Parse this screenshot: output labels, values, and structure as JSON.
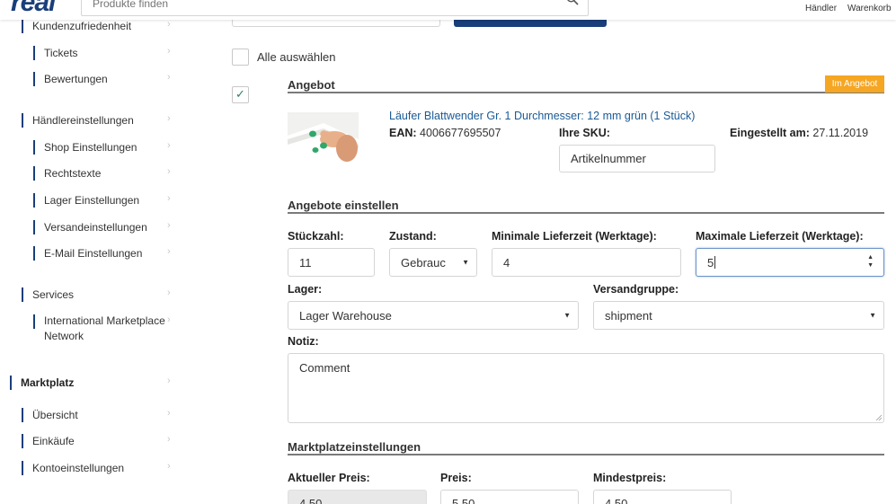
{
  "header": {
    "logo": "real",
    "search_placeholder": "Produkte finden",
    "haendler": "Händler",
    "warenkorb": "Warenkorb"
  },
  "sidebar": {
    "items": [
      {
        "label": "Kundenzufriedenheit"
      },
      {
        "label": "Tickets"
      },
      {
        "label": "Bewertungen"
      },
      {
        "label": "Händlereinstellungen"
      },
      {
        "label": "Shop Einstellungen"
      },
      {
        "label": "Rechtstexte"
      },
      {
        "label": "Lager Einstellungen"
      },
      {
        "label": "Versandeinstellungen"
      },
      {
        "label": "E-Mail Einstellungen"
      },
      {
        "label": "Services"
      },
      {
        "label": "International Marketplace Network"
      },
      {
        "label": "Marktplatz"
      },
      {
        "label": "Übersicht"
      },
      {
        "label": "Einkäufe"
      },
      {
        "label": "Kontoeinstellungen"
      }
    ]
  },
  "select_all": {
    "label": "Alle auswählen",
    "checked": false
  },
  "offer": {
    "checked": true,
    "title": "Angebot",
    "badge": "Im Angebot",
    "product_title": "Läufer Blattwender Gr. 1 Durchmesser: 12 mm grün (1 Stück)",
    "ean_label": "EAN:",
    "ean_value": "4006677695507",
    "sku_label": "Ihre SKU:",
    "sku_value": "Artikelnummer",
    "listed_label": "Eingestellt am:",
    "listed_value": "27.11.2019"
  },
  "offer_settings": {
    "title": "Angebote einstellen",
    "quantity_label": "Stückzahl:",
    "quantity_value": "11",
    "condition_label": "Zustand:",
    "condition_value": "Gebrauc",
    "min_delivery_label": "Minimale Lieferzeit (Werktage):",
    "min_delivery_value": "4",
    "max_delivery_label": "Maximale Lieferzeit (Werktage):",
    "max_delivery_value": "5",
    "warehouse_label": "Lager:",
    "warehouse_value": "Lager Warehouse",
    "shipping_group_label": "Versandgruppe:",
    "shipping_group_value": "shipment",
    "note_label": "Notiz:",
    "note_value": "Comment"
  },
  "marketplace": {
    "title": "Marktplatzeinstellungen",
    "current_price_label": "Aktueller Preis:",
    "current_price_value": "4,50",
    "price_label": "Preis:",
    "price_value": "5,50",
    "min_price_label": "Mindestpreis:",
    "min_price_value": "4,50"
  },
  "colors": {
    "brand": "#1a3e7a",
    "badge": "#f5a623",
    "link": "#1a5a96",
    "check": "#2e7d6b"
  }
}
